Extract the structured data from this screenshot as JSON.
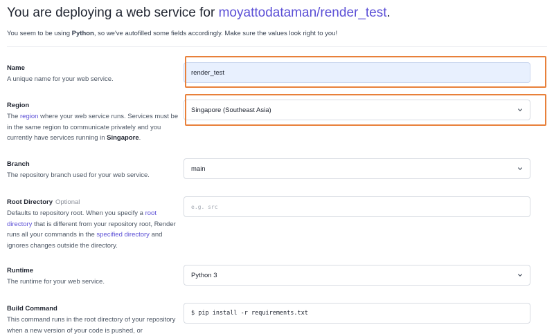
{
  "header": {
    "title_prefix": "You are deploying a web service for ",
    "repo": "moyattodataman/render_test",
    "title_suffix": "."
  },
  "subtitle": {
    "part1": "You seem to be using ",
    "language": "Python",
    "part2": ", so we've autofilled some fields accordingly. Make sure the values look right to you!"
  },
  "name": {
    "label": "Name",
    "desc": "A unique name for your web service.",
    "value": "render_test"
  },
  "region": {
    "label": "Region",
    "desc_part1": "The ",
    "desc_link": "region",
    "desc_part2": " where your web service runs. Services must be in the same region to communicate privately and you currently have services running in ",
    "desc_bold": "Singapore",
    "desc_part3": ".",
    "value": "Singapore (Southeast Asia)"
  },
  "branch": {
    "label": "Branch",
    "desc": "The repository branch used for your web service.",
    "value": "main"
  },
  "root_directory": {
    "label": "Root Directory",
    "optional": "Optional",
    "desc_part1": "Defaults to repository root. When you specify a ",
    "desc_link1": "root directory",
    "desc_part2": " that is different from your repository root, Render runs all your commands in the ",
    "desc_link2": "specified directory",
    "desc_part3": " and ignores changes outside the directory.",
    "placeholder": "e.g. src"
  },
  "runtime": {
    "label": "Runtime",
    "desc": "The runtime for your web service.",
    "value": "Python 3"
  },
  "build_command": {
    "label": "Build Command",
    "desc": "This command runs in the root directory of your repository when a new version of your code is pushed, or",
    "value": "$ pip install -r requirements.txt"
  },
  "colors": {
    "accent": "#5b4fd6",
    "highlight": "#e8803a",
    "filled_field": "#e8f0fe"
  },
  "icons": {
    "select": "chevron-down-icon"
  }
}
